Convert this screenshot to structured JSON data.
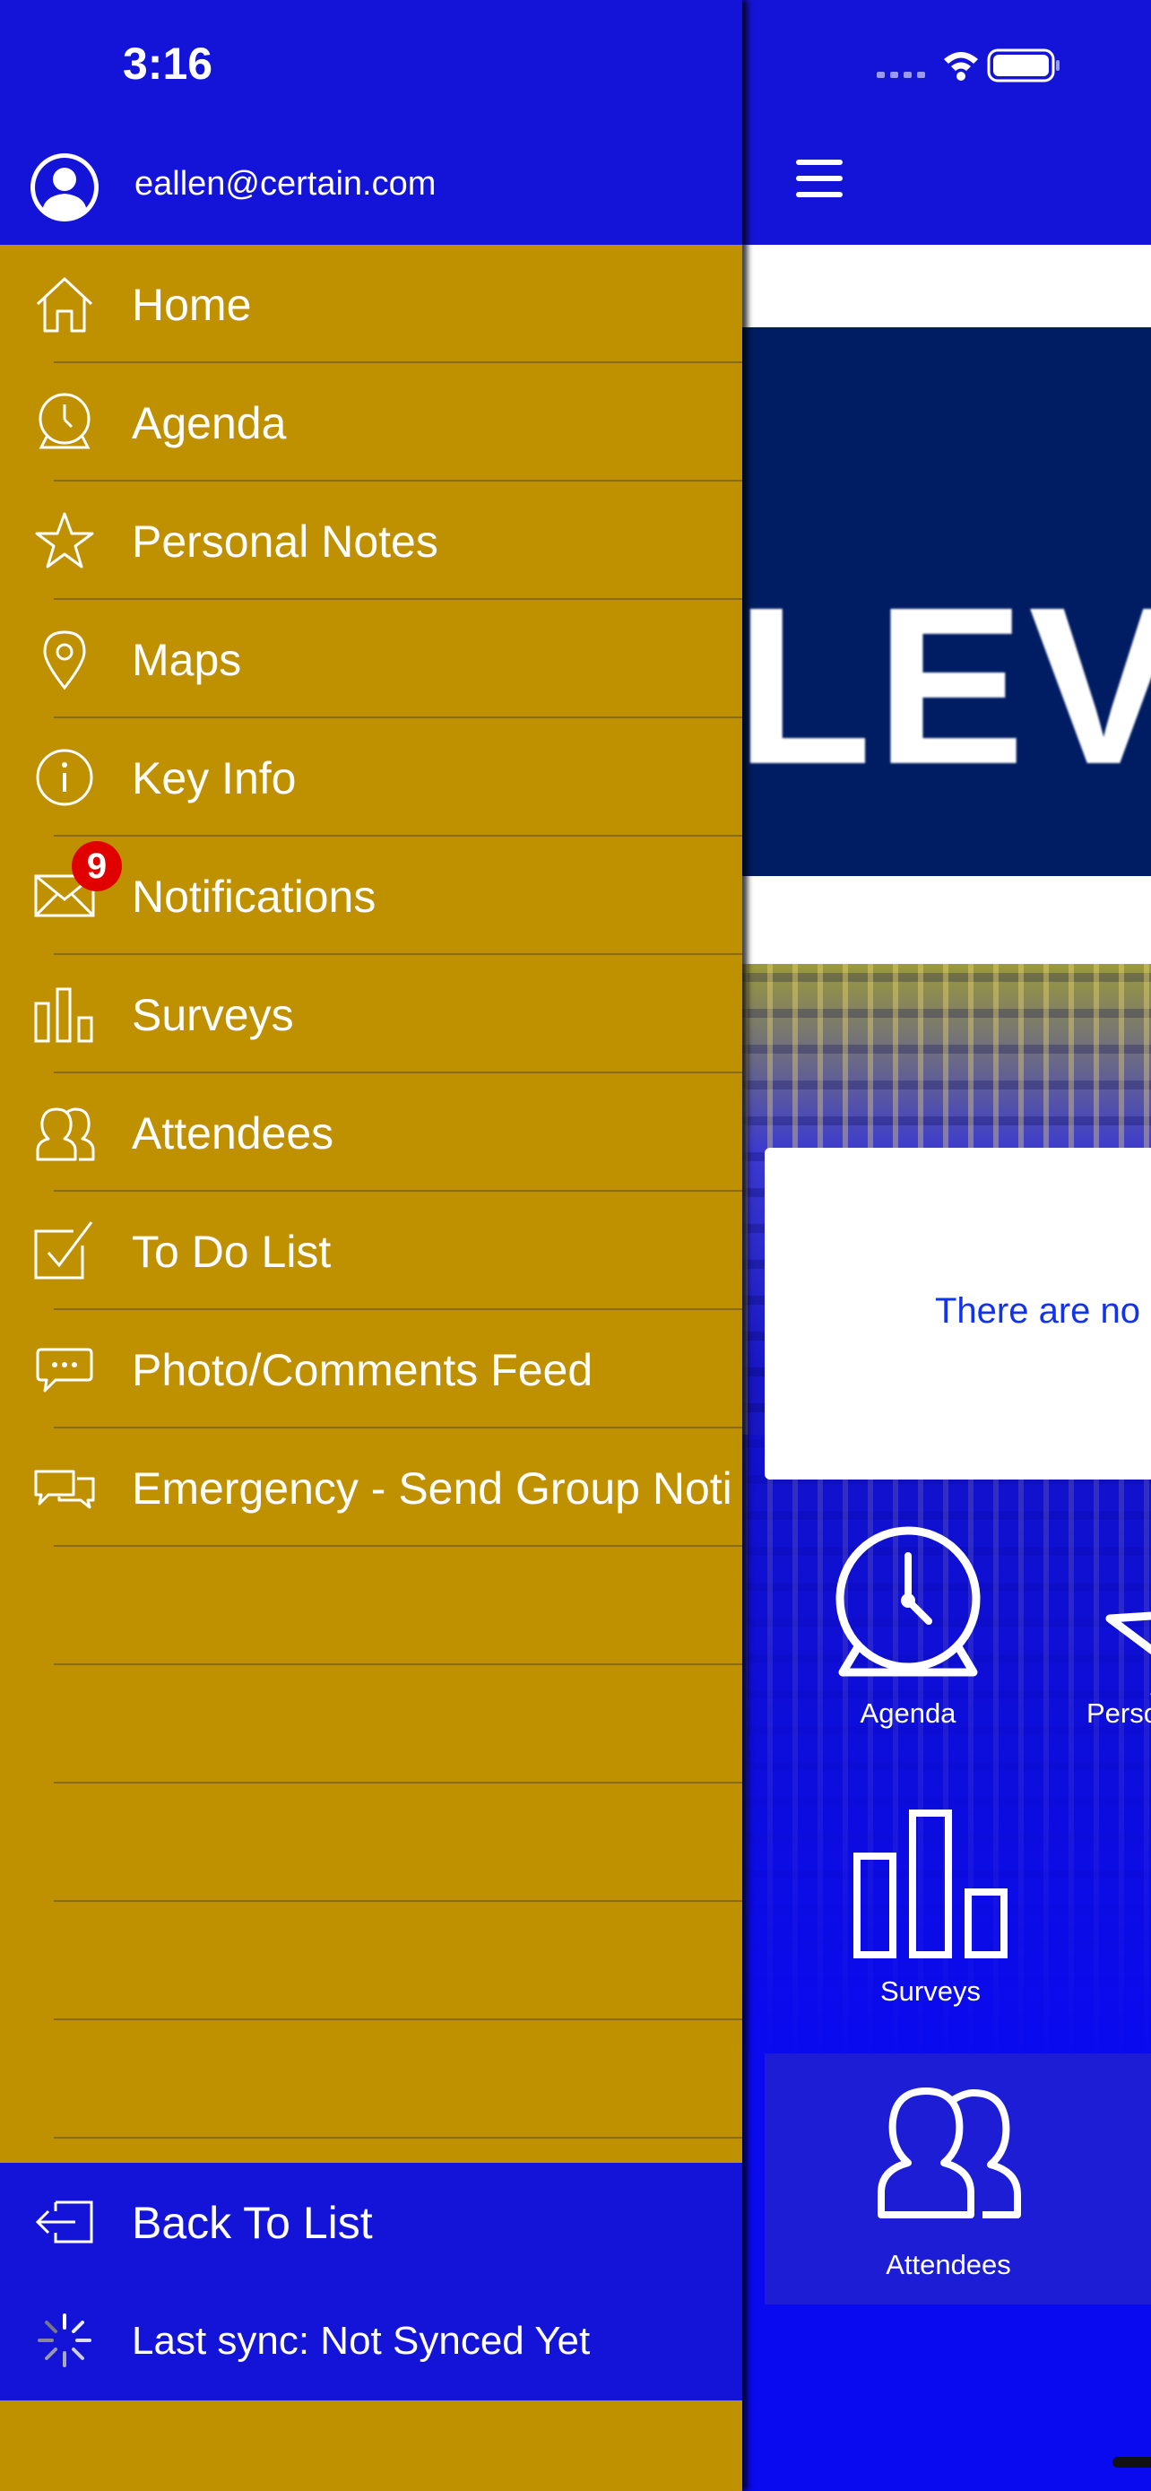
{
  "status_bar": {
    "time": "3:16"
  },
  "account": {
    "email": "eallen@certain.com"
  },
  "menu": {
    "items": [
      {
        "label": "Home",
        "icon": "home-icon"
      },
      {
        "label": "Agenda",
        "icon": "clock-icon"
      },
      {
        "label": "Personal Notes",
        "icon": "star-icon"
      },
      {
        "label": "Maps",
        "icon": "map-pin-icon"
      },
      {
        "label": "Key Info",
        "icon": "info-icon"
      },
      {
        "label": "Notifications",
        "icon": "mail-icon",
        "badge": "9"
      },
      {
        "label": "Surveys",
        "icon": "bar-chart-icon"
      },
      {
        "label": "Attendees",
        "icon": "people-icon"
      },
      {
        "label": "To Do List",
        "icon": "checkbox-icon"
      },
      {
        "label": "Photo/Comments Feed",
        "icon": "comment-icon"
      },
      {
        "label": "Emergency - Send Group Noti",
        "icon": "chat-bubbles-icon"
      }
    ]
  },
  "footer": {
    "back_label": "Back To List",
    "sync_label": "Last sync:  Not Synced Yet"
  },
  "main": {
    "banner_text": "LEV",
    "empty_message": "There are no",
    "tiles": {
      "agenda": "Agenda",
      "personal": "Perso",
      "surveys": "Surveys",
      "attendees": "Attendees"
    }
  },
  "colors": {
    "drawer_bg": "#bf9000",
    "header_bg": "#1414d8",
    "main_bg": "#0a0af0",
    "badge": "#e00000",
    "navy_banner": "#001d63"
  }
}
